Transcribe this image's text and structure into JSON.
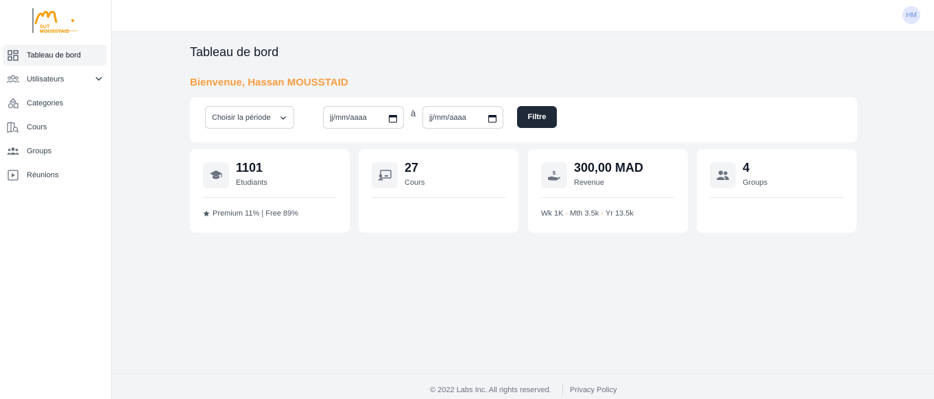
{
  "brand": {
    "logo_text": "SUT MOUSSTAID",
    "logo_sub": "PROFESSIONAL ENTERPRISE GROUP",
    "accent": "#f59e42"
  },
  "sidebar": {
    "items": [
      {
        "label": "Tableau de bord",
        "icon": "dashboard-icon",
        "active": true
      },
      {
        "label": "Utilisateurs",
        "icon": "users-icon",
        "expandable": true
      },
      {
        "label": "Categories",
        "icon": "shapes-icon"
      },
      {
        "label": "Cours",
        "icon": "book-search-icon"
      },
      {
        "label": "Groups",
        "icon": "users-group-icon"
      },
      {
        "label": "Réunions",
        "icon": "play-square-icon"
      }
    ]
  },
  "topbar": {
    "avatar_initials": "HM"
  },
  "main": {
    "title": "Tableau de bord",
    "welcome": "Bienvenue, Hassan MOUSSTAID",
    "filter": {
      "period_select": "Choisir la période",
      "date_from": "jj/mm/aaaa",
      "separator": "à",
      "date_to": "jj/mm/aaaa",
      "button": "Filtre"
    },
    "stats": [
      {
        "value": "1101",
        "label": "Etudiants",
        "icon": "graduation-cap-icon",
        "footer": "Premium 11% | Free 89%"
      },
      {
        "value": "27",
        "label": "Cours",
        "icon": "presentation-icon",
        "footer": ""
      },
      {
        "value": "300,00 MAD",
        "label": "Revenue",
        "icon": "money-hand-icon",
        "footer_parts": [
          "Wk 1K",
          "Mth 3.5k",
          "Yr 13.5k"
        ]
      },
      {
        "value": "4",
        "label": "Groups",
        "icon": "people-icon",
        "footer": ""
      }
    ]
  },
  "footer": {
    "copyright": "© 2022 Labs Inc. All rights reserved.",
    "privacy": "Privacy Policy"
  }
}
